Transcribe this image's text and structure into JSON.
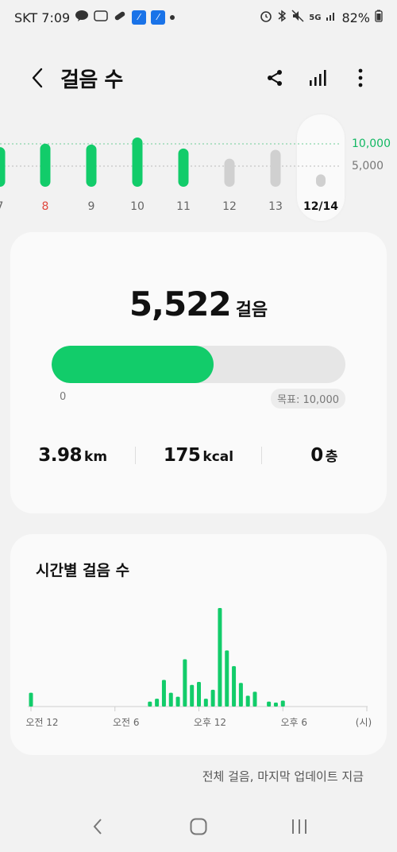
{
  "status_bar": {
    "carrier_time": "SKT 7:09",
    "battery": "82%",
    "network": "5G"
  },
  "header": {
    "title": "걸음 수",
    "icons": [
      "back-icon",
      "share-icon",
      "bar-chart-icon",
      "more-icon"
    ]
  },
  "daily_chart": {
    "goal_high_label": "10,000",
    "goal_mid_label": "5,000",
    "days": [
      {
        "label": "7",
        "value": 9000,
        "reached": true,
        "weekend": false
      },
      {
        "label": "8",
        "value": 9800,
        "reached": true,
        "weekend": true
      },
      {
        "label": "9",
        "value": 9600,
        "reached": true,
        "weekend": false
      },
      {
        "label": "10",
        "value": 11200,
        "reached": true,
        "weekend": false
      },
      {
        "label": "11",
        "value": 8700,
        "reached": true,
        "weekend": false
      },
      {
        "label": "12",
        "value": 6400,
        "reached": false,
        "weekend": false
      },
      {
        "label": "13",
        "value": 8400,
        "reached": false,
        "weekend": false
      },
      {
        "label": "12/14",
        "value": 5522,
        "reached": false,
        "weekend": false,
        "selected": true
      }
    ],
    "colors": {
      "reached": "#12cc6a",
      "not_reached": "#d0d0d0",
      "weekend_label": "#e0483e"
    }
  },
  "summary": {
    "steps": "5,522",
    "steps_unit": "걸음",
    "progress": 0.5522,
    "progress_start": "0",
    "goal_text": "목표: 10,000",
    "distance": "3.98",
    "distance_unit": "km",
    "calories": "175",
    "calories_unit": "kcal",
    "floors": "0",
    "floors_unit": "층"
  },
  "hourly": {
    "title": "시간별 걸음 수",
    "x_labels": [
      "오전 12",
      "오전 6",
      "오후 12",
      "오후 6",
      "(시)"
    ],
    "chart_data": {
      "type": "bar",
      "x": [
        0,
        17,
        18,
        19,
        20,
        21,
        22,
        23,
        24,
        25,
        26,
        27,
        28,
        29,
        30,
        31,
        32,
        33,
        34,
        35,
        36
      ],
      "values": [
        14,
        5,
        8,
        27,
        14,
        10,
        48,
        22,
        25,
        8,
        17,
        100,
        57,
        41,
        24,
        11,
        15,
        5,
        4,
        5
      ],
      "note": ""
    },
    "bars": [
      {
        "slot": 0,
        "v": 14
      },
      {
        "slot": 17,
        "v": 5
      },
      {
        "slot": 18,
        "v": 8
      },
      {
        "slot": 19,
        "v": 27
      },
      {
        "slot": 20,
        "v": 14
      },
      {
        "slot": 21,
        "v": 10
      },
      {
        "slot": 22,
        "v": 48
      },
      {
        "slot": 23,
        "v": 22
      },
      {
        "slot": 24,
        "v": 25
      },
      {
        "slot": 25,
        "v": 8
      },
      {
        "slot": 26,
        "v": 17
      },
      {
        "slot": 27,
        "v": 100
      },
      {
        "slot": 28,
        "v": 57
      },
      {
        "slot": 29,
        "v": 41
      },
      {
        "slot": 30,
        "v": 24
      },
      {
        "slot": 31,
        "v": 11
      },
      {
        "slot": 32,
        "v": 15
      },
      {
        "slot": 34,
        "v": 5
      },
      {
        "slot": 35,
        "v": 4
      },
      {
        "slot": 36,
        "v": 6
      }
    ],
    "bar_color": "#12cc6a"
  },
  "footer": {
    "note": "전체 걸음, 마지막 업데이트 지금"
  },
  "nav": {
    "icons": [
      "recent-apps-icon",
      "home-icon",
      "back-nav-icon"
    ]
  }
}
